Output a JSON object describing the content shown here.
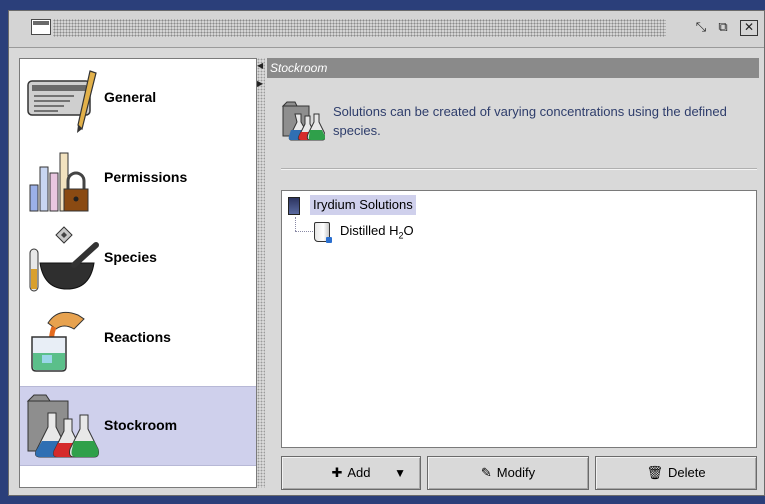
{
  "window": {
    "title": ""
  },
  "sidebar": {
    "items": [
      {
        "label": "General",
        "icon": "document-pen-icon",
        "selected": false
      },
      {
        "label": "Permissions",
        "icon": "bar-chart-lock-icon",
        "selected": false
      },
      {
        "label": "Species",
        "icon": "test-tube-mortar-icon",
        "selected": false
      },
      {
        "label": "Reactions",
        "icon": "beaker-pour-icon",
        "selected": false
      },
      {
        "label": "Stockroom",
        "icon": "flasks-icon",
        "selected": true
      }
    ]
  },
  "panel": {
    "header": "Stockroom",
    "description": "Solutions can be created of varying concentrations using the defined species."
  },
  "tree": {
    "root": {
      "label": "Irydium Solutions",
      "icon": "solution-set-icon"
    },
    "children": [
      {
        "label_main": "Distilled H",
        "label_sub": "2",
        "label_tail": "O",
        "icon": "bottle-icon"
      }
    ]
  },
  "buttons": {
    "add": "Add",
    "modify": "Modify",
    "delete": "Delete"
  },
  "colors": {
    "selection": "#cfd0ec",
    "panel_header": "#8a8a8a",
    "info_text": "#2e3d6b",
    "desktop": "#2b3f7a"
  }
}
